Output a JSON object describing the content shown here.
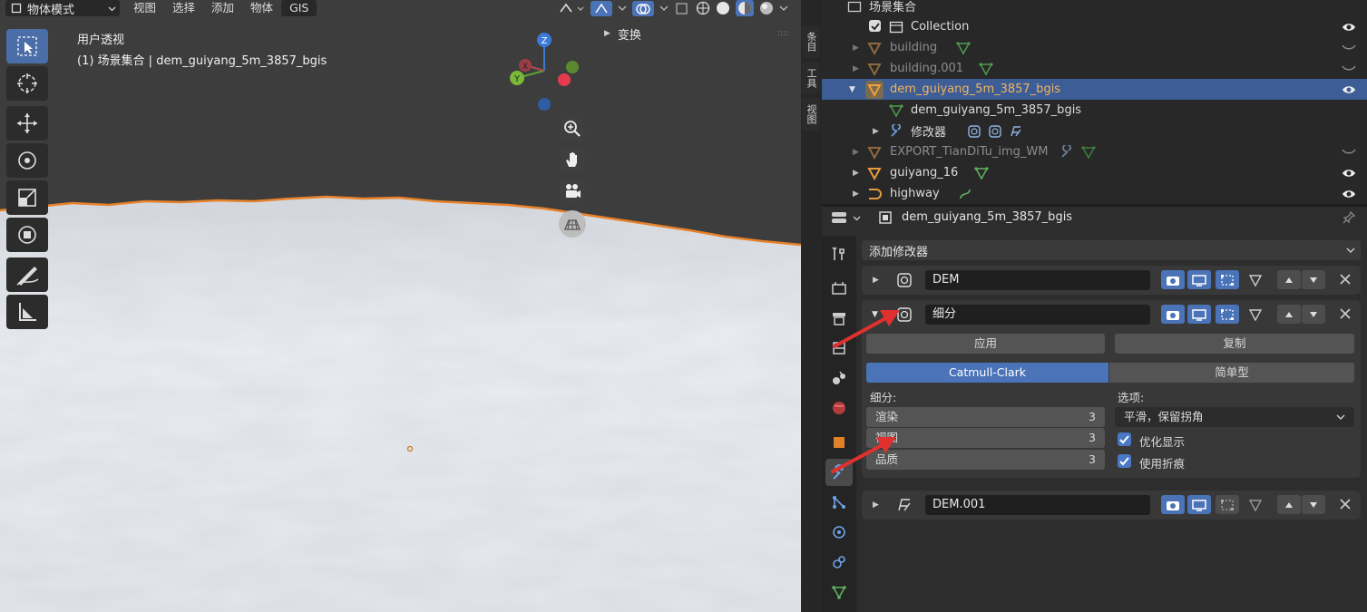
{
  "viewport": {
    "header": {
      "mode_label": "物体模式",
      "menus": [
        "视图",
        "选择",
        "添加",
        "物体",
        "GIS"
      ]
    },
    "overlay_title": "用户透视",
    "overlay_subtitle": "(1) 场景集合 | dem_guiyang_5m_3857_bgis",
    "gizmo": {
      "z": "Z",
      "x": "X",
      "y": "Y"
    },
    "n_panel_label": "变换",
    "side_tabs": [
      "条目",
      "工具",
      "视图"
    ],
    "tools": [
      "select-box-icon",
      "cursor-icon",
      "move-icon",
      "rotate-icon",
      "scale-icon",
      "transform-icon",
      "annotate-icon",
      "measure-icon"
    ],
    "colors": {
      "viewport_bg": "#3d3d3d",
      "terrain": "#e9ecf0",
      "selection_outline": "#e8822a"
    }
  },
  "outliner": {
    "root": "场景集合",
    "items": [
      {
        "name": "Collection",
        "state": "normal"
      },
      {
        "name": "building",
        "state": "hidden"
      },
      {
        "name": "building.001",
        "state": "hidden"
      },
      {
        "name": "dem_guiyang_5m_3857_bgis",
        "state": "selected"
      },
      {
        "name": "dem_guiyang_5m_3857_bgis",
        "state": "child-mesh"
      },
      {
        "name": "修改器",
        "state": "child-modifiers"
      },
      {
        "name": "EXPORT_TianDiTu_img_WM",
        "state": "hidden"
      },
      {
        "name": "guiyang_16",
        "state": "normal"
      },
      {
        "name": "highway",
        "state": "normal"
      }
    ]
  },
  "properties": {
    "object_name": "dem_guiyang_5m_3857_bgis",
    "add_modifier": "添加修改器",
    "modifiers": {
      "dem": {
        "name": "DEM"
      },
      "subdiv": {
        "name": "细分",
        "apply": "应用",
        "copy": "复制",
        "algo_catmull": "Catmull-Clark",
        "algo_simple": "简单型",
        "levels_label": "细分:",
        "render_label": "渲染",
        "render_value": "3",
        "viewport_label": "视图",
        "viewport_value": "3",
        "quality_label": "品质",
        "quality_value": "3",
        "options_label": "选项:",
        "uv_smooth": "平滑，保留拐角",
        "optimal_display": "优化显示",
        "use_creases": "使用折痕"
      },
      "dem001": {
        "name": "DEM.001"
      }
    },
    "colors": {
      "accent": "#4a73b8",
      "panel": "#383838",
      "annotation_arrow": "#e0312f"
    }
  }
}
